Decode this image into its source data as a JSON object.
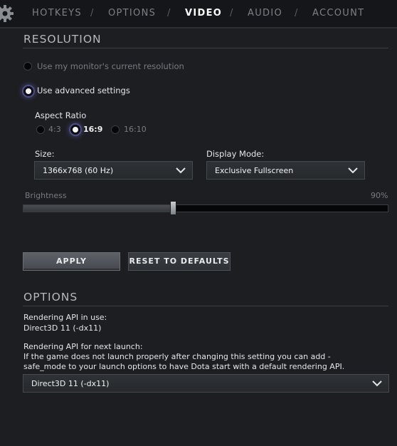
{
  "nav": {
    "tabs": [
      {
        "label": "HOTKEYS"
      },
      {
        "label": "OPTIONS"
      },
      {
        "label": "VIDEO"
      },
      {
        "label": "AUDIO"
      },
      {
        "label": "ACCOUNT"
      }
    ],
    "separator": "/",
    "active_tab": "VIDEO",
    "settings_icon": "gear-icon"
  },
  "resolution": {
    "title": "RESOLUTION",
    "monitor_option": "Use my monitor's current resolution",
    "advanced_option": "Use advanced settings",
    "selected_option": "Use advanced settings",
    "aspect_ratio": {
      "label": "Aspect Ratio",
      "options": [
        "4:3",
        "16:9",
        "16:10"
      ],
      "selected": "16:9"
    },
    "size": {
      "label": "Size:",
      "value": "1366x768 (60 Hz)"
    },
    "display_mode": {
      "label": "Display Mode:",
      "value": "Exclusive Fullscreen"
    },
    "brightness": {
      "label": "Brightness",
      "value_text": "90%",
      "fraction": 0.41
    }
  },
  "actions": {
    "apply": "APPLY",
    "reset": "RESET TO DEFAULTS"
  },
  "options": {
    "title": "OPTIONS",
    "api_in_use_label": "Rendering API in use:",
    "api_in_use_value": "Direct3D 11 (-dx11)",
    "api_next_label": "Rendering API for next launch:",
    "api_next_note_line1": "If the game does not launch properly after changing this setting you can add -",
    "api_next_note_line2": "safe_mode to your launch options to have Dota start with a default rendering API.",
    "api_next_value": "Direct3D 11 (-dx11)"
  },
  "colors": {
    "background": "#1c1e21",
    "tab_bar": "#141619",
    "radio_glow": "#4d4d86"
  }
}
